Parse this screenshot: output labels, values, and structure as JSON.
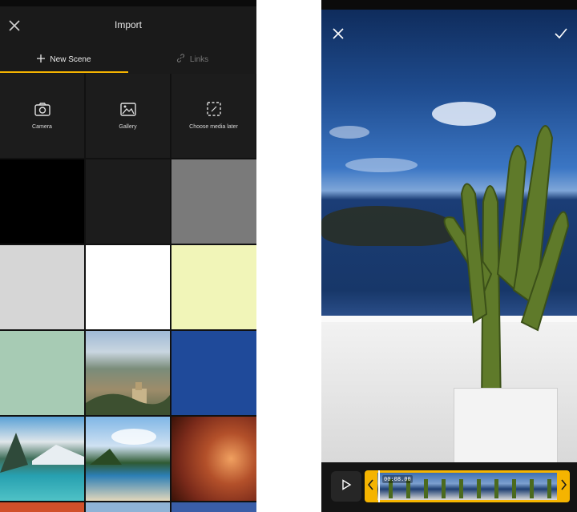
{
  "left_panel": {
    "title": "Import",
    "close_icon": "close-icon",
    "tabs": [
      {
        "label": "New Scene",
        "icon": "plus-icon",
        "active": true
      },
      {
        "label": "Links",
        "icon": "link-icon",
        "active": false
      }
    ],
    "sources": [
      {
        "label": "Camera",
        "icon": "camera-icon"
      },
      {
        "label": "Gallery",
        "icon": "image-icon"
      },
      {
        "label": "Choose media later",
        "icon": "placeholder-icon"
      }
    ],
    "color_swatches": [
      "#000000",
      "#1c1c1c",
      "#7a7a7a",
      "#d6d6d6",
      "#ffffff",
      "#f1f5b8",
      "#a7cbb4",
      "#1f4a9a"
    ],
    "photos": [
      "hillside-town",
      "mountain-lake",
      "tropical-beach",
      "red-canyon"
    ]
  },
  "right_panel": {
    "close_icon": "close-icon",
    "confirm_icon": "check-icon",
    "play_icon": "play-icon",
    "timeline": {
      "time": "00:08.00",
      "left_handle_icon": "chevron-left-icon",
      "right_handle_icon": "chevron-right-icon"
    }
  },
  "colors": {
    "accent": "#f5b400",
    "background_dark": "#111111",
    "topbar": "#1a1a1a"
  }
}
